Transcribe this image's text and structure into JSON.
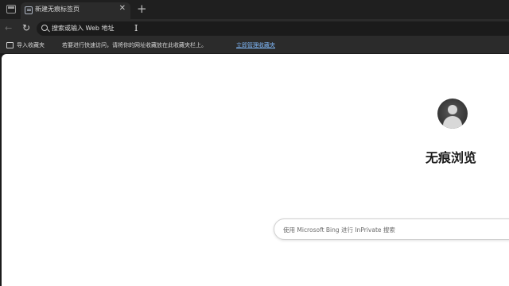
{
  "tab": {
    "title": "新建无痕标签页",
    "close_glyph": "✕"
  },
  "tabstrip": {
    "new_tab_glyph": "+"
  },
  "toolbar": {
    "back_glyph": "←",
    "refresh_glyph": "↻"
  },
  "addressbar": {
    "text": "搜索或输入 Web 地址",
    "cursor_glyph": "I"
  },
  "favorites_bar": {
    "import_label": "导入收藏夹",
    "hint": "若要进行快速访问，请将你的网址收藏放在此收藏夹栏上。",
    "manage_link": "立即管理收藏夹"
  },
  "content": {
    "title": "无痕浏览",
    "search_placeholder": "使用 Microsoft Bing 进行 InPrivate 搜索"
  },
  "colors": {
    "frame": "#1f1f1f",
    "toolbar": "#2b2b2b",
    "link": "#7fb6f5",
    "content_bg": "#ffffff"
  }
}
